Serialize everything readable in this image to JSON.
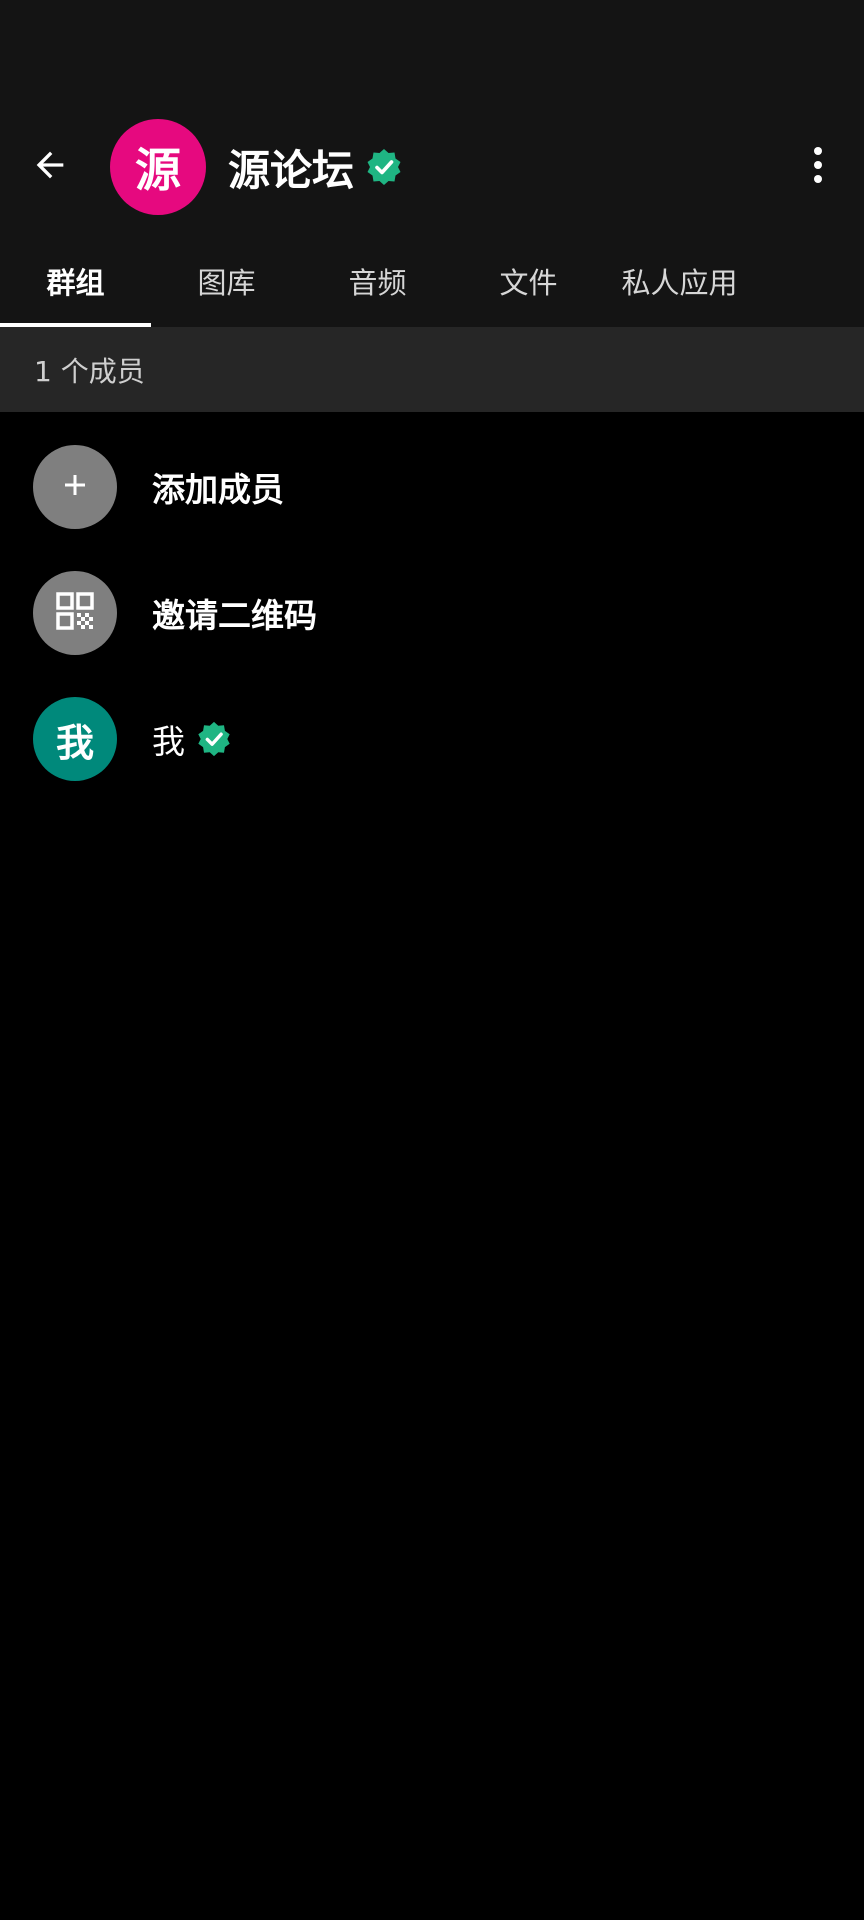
{
  "header": {
    "avatar_char": "源",
    "title": "源论坛"
  },
  "tabs": [
    {
      "label": "群组",
      "active": true
    },
    {
      "label": "图库",
      "active": false
    },
    {
      "label": "音频",
      "active": false
    },
    {
      "label": "文件",
      "active": false
    },
    {
      "label": "私人应用",
      "active": false
    }
  ],
  "members_section": {
    "count_label": "1 个成员"
  },
  "rows": {
    "add_member": {
      "label": "添加成员",
      "icon": "plus-icon"
    },
    "invite_qr": {
      "label": "邀请二维码",
      "icon": "qr-code-icon"
    },
    "me": {
      "avatar_char": "我",
      "label": "我"
    }
  },
  "colors": {
    "group_avatar": "#e6097f",
    "verified": "#1fb583",
    "me_avatar": "#00897b",
    "action_avatar": "#7f7f7f",
    "bar_bg": "#141414",
    "section_bg": "#262626"
  }
}
